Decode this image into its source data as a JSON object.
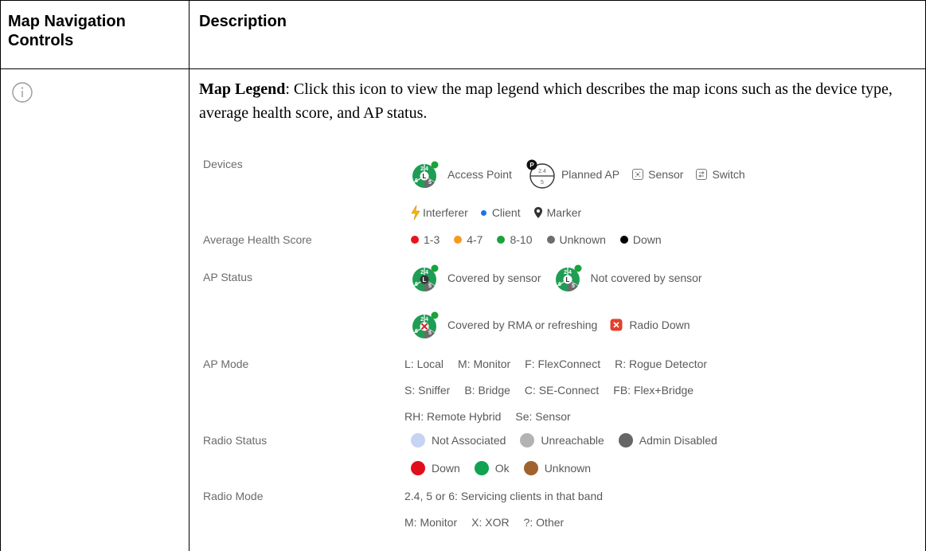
{
  "table": {
    "header_col1": "Map Navigation Controls",
    "header_col1_line1": "Map Navigation",
    "header_col1_line2": "Controls",
    "header_col2": "Description"
  },
  "row": {
    "icon": "info-icon",
    "title": "Map Legend",
    "text": ": Click this icon to view the map legend which describes the map icons such as the device type, average health score, and AP status."
  },
  "legend": {
    "devices": {
      "label": "Devices",
      "access_point": "Access Point",
      "planned_ap": "Planned AP",
      "sensor": "Sensor",
      "switch": "Switch",
      "interferer": "Interferer",
      "client": "Client",
      "marker": "Marker"
    },
    "health": {
      "label": "Average Health Score",
      "items": [
        {
          "text": "1-3",
          "color": "#e8141a"
        },
        {
          "text": "4-7",
          "color": "#f59a1d"
        },
        {
          "text": "8-10",
          "color": "#1aa33a"
        },
        {
          "text": "Unknown",
          "color": "#6d6d6d"
        },
        {
          "text": "Down",
          "color": "#000000"
        }
      ]
    },
    "ap_status": {
      "label": "AP Status",
      "covered": "Covered by sensor",
      "not_covered": "Not covered by sensor",
      "rma": "Covered by RMA or refreshing",
      "radio_down": "Radio Down"
    },
    "ap_mode": {
      "label": "AP Mode",
      "line1": [
        "L: Local",
        "M: Monitor",
        "F: FlexConnect",
        "R: Rogue Detector"
      ],
      "line2": [
        "S: Sniffer",
        "B: Bridge",
        "C: SE-Connect",
        "FB: Flex+Bridge"
      ],
      "line3": [
        "RH: Remote Hybrid",
        "Se: Sensor"
      ]
    },
    "radio_status": {
      "label": "Radio Status",
      "line1": [
        {
          "text": "Not Associated",
          "color": "#c7d3f3"
        },
        {
          "text": "Unreachable",
          "color": "#b3b3b3"
        },
        {
          "text": "Admin Disabled",
          "color": "#666666"
        }
      ],
      "line2": [
        {
          "text": "Down",
          "color": "#e10f1c"
        },
        {
          "text": "Ok",
          "color": "#12a251"
        },
        {
          "text": "Unknown",
          "color": "#a0622f"
        }
      ]
    },
    "radio_mode": {
      "label": "Radio Mode",
      "line1": "2.4, 5 or 6: Servicing clients in that band",
      "line2": [
        "M: Monitor",
        "X: XOR",
        "?: Other"
      ]
    },
    "ap_icon": {
      "top": "2.4",
      "left": "6",
      "right": "5",
      "center": "L"
    },
    "planned_icon": {
      "badge": "P",
      "top": "2.4",
      "bottom": "5"
    }
  }
}
